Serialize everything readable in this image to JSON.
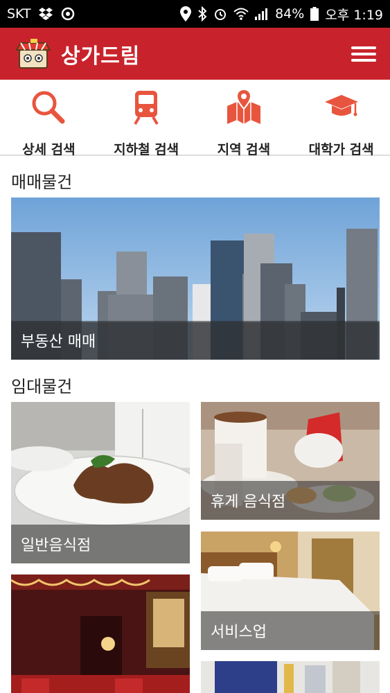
{
  "status_bar": {
    "carrier": "SKT",
    "battery": "84%",
    "time": "오후 1:19"
  },
  "header": {
    "title": "상가드림"
  },
  "search_nav": [
    {
      "label": "상세 검색",
      "icon": "search-icon"
    },
    {
      "label": "지하철 검색",
      "icon": "subway-icon"
    },
    {
      "label": "지역 검색",
      "icon": "map-pin-icon"
    },
    {
      "label": "대학가 검색",
      "icon": "graduation-cap-icon"
    }
  ],
  "sale_section": {
    "title": "매매물건",
    "card": {
      "label": "부동산 매매"
    }
  },
  "rent_section": {
    "title": "임대물건",
    "cards": [
      {
        "label": "일반음식점"
      },
      {
        "label": "휴게 음식점"
      },
      {
        "label": "서비스업"
      }
    ]
  },
  "colors": {
    "brand": "#c8232c",
    "icon_accent": "#e8553e"
  }
}
